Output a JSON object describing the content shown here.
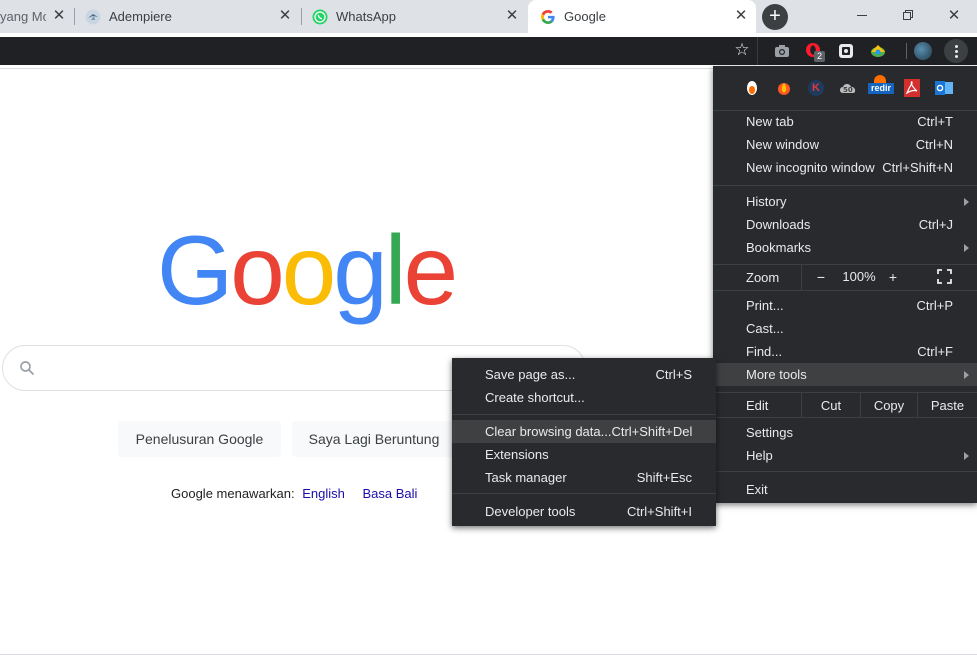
{
  "tabs": [
    {
      "label": "yang Mo"
    },
    {
      "label": "Adempiere"
    },
    {
      "label": "WhatsApp"
    },
    {
      "label": "Google"
    }
  ],
  "tab_close_glyph": "✕",
  "window_controls": {
    "minimize": "—",
    "restore": "❐",
    "close": "✕"
  },
  "new_tab_glyph": "+",
  "toolbar": {
    "opera_badge": "2"
  },
  "google": {
    "logo_letters": [
      "G",
      "o",
      "o",
      "g",
      "l",
      "e"
    ],
    "logo_colors": [
      "#4285f4",
      "#ea4335",
      "#fbbc05",
      "#4285f4",
      "#34a853",
      "#ea4335"
    ],
    "search_placeholder": "",
    "search_button": "Penelusuran Google",
    "lucky_button": "Saya Lagi Beruntung",
    "offered_text": "Google menawarkan:",
    "languages": [
      "English",
      "Basa Bali"
    ]
  },
  "main_menu": {
    "extension_icons": [
      "ext-bulb-icon",
      "ext-flame-icon",
      "ext-k-icon",
      "ext-cloud-icon",
      "ext-redirect-icon",
      "ext-pdf-icon",
      "ext-outlook-icon"
    ],
    "redir_label": "redir",
    "k_label": "K",
    "new_tab": {
      "label": "New tab",
      "shortcut": "Ctrl+T"
    },
    "new_window": {
      "label": "New window",
      "shortcut": "Ctrl+N"
    },
    "new_incognito": {
      "label": "New incognito window",
      "shortcut": "Ctrl+Shift+N"
    },
    "history": {
      "label": "History"
    },
    "downloads": {
      "label": "Downloads",
      "shortcut": "Ctrl+J"
    },
    "bookmarks": {
      "label": "Bookmarks"
    },
    "zoom": {
      "label": "Zoom",
      "minus": "−",
      "value": "100%",
      "plus": "+"
    },
    "print": {
      "label": "Print...",
      "shortcut": "Ctrl+P"
    },
    "cast": {
      "label": "Cast..."
    },
    "find": {
      "label": "Find...",
      "shortcut": "Ctrl+F"
    },
    "more_tools": {
      "label": "More tools"
    },
    "edit": {
      "label": "Edit",
      "cut": "Cut",
      "copy": "Copy",
      "paste": "Paste"
    },
    "settings": {
      "label": "Settings"
    },
    "help": {
      "label": "Help"
    },
    "exit": {
      "label": "Exit"
    }
  },
  "sub_menu": {
    "save_page": {
      "label": "Save page as...",
      "shortcut": "Ctrl+S"
    },
    "create_shortcut": {
      "label": "Create shortcut..."
    },
    "clear_browsing": {
      "label": "Clear browsing data...",
      "shortcut": "Ctrl+Shift+Del"
    },
    "extensions": {
      "label": "Extensions"
    },
    "task_manager": {
      "label": "Task manager",
      "shortcut": "Shift+Esc"
    },
    "developer_tools": {
      "label": "Developer tools",
      "shortcut": "Ctrl+Shift+I"
    }
  },
  "colors": {
    "menu_bg": "#292a2d",
    "menu_highlight": "#3f4042",
    "toolbar_bg": "#202124",
    "tabstrip_bg": "#dee1e6",
    "link": "#1a0dab"
  }
}
